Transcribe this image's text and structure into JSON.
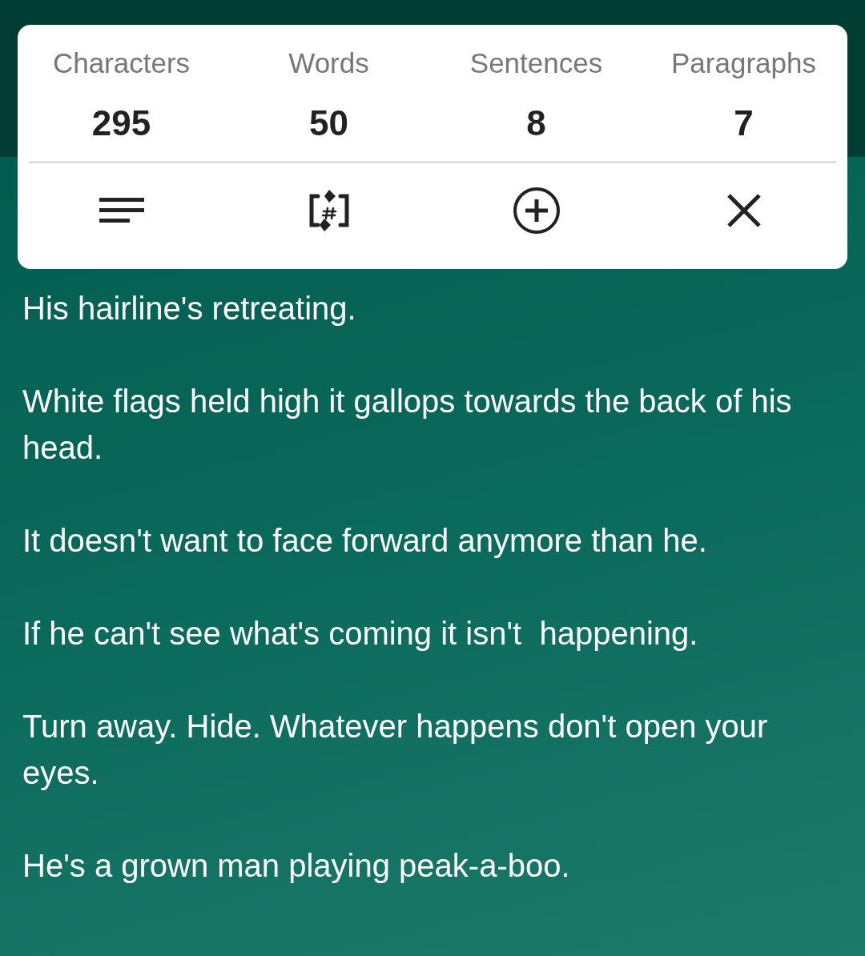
{
  "stats": [
    {
      "label": "Characters",
      "value": "295"
    },
    {
      "label": "Words",
      "value": "50"
    },
    {
      "label": "Sentences",
      "value": "8"
    },
    {
      "label": "Paragraphs",
      "value": "7"
    }
  ],
  "paragraphs": [
    "His hairline's retreating.",
    "White flags held high it gallops towards the back of his head.",
    "It doesn't want to face forward anymore than he.",
    "If he can't see what's coming it isn't  happening.",
    "Turn away. Hide. Whatever happens don't open your eyes.",
    "He's a grown man playing peak-a-boo."
  ]
}
